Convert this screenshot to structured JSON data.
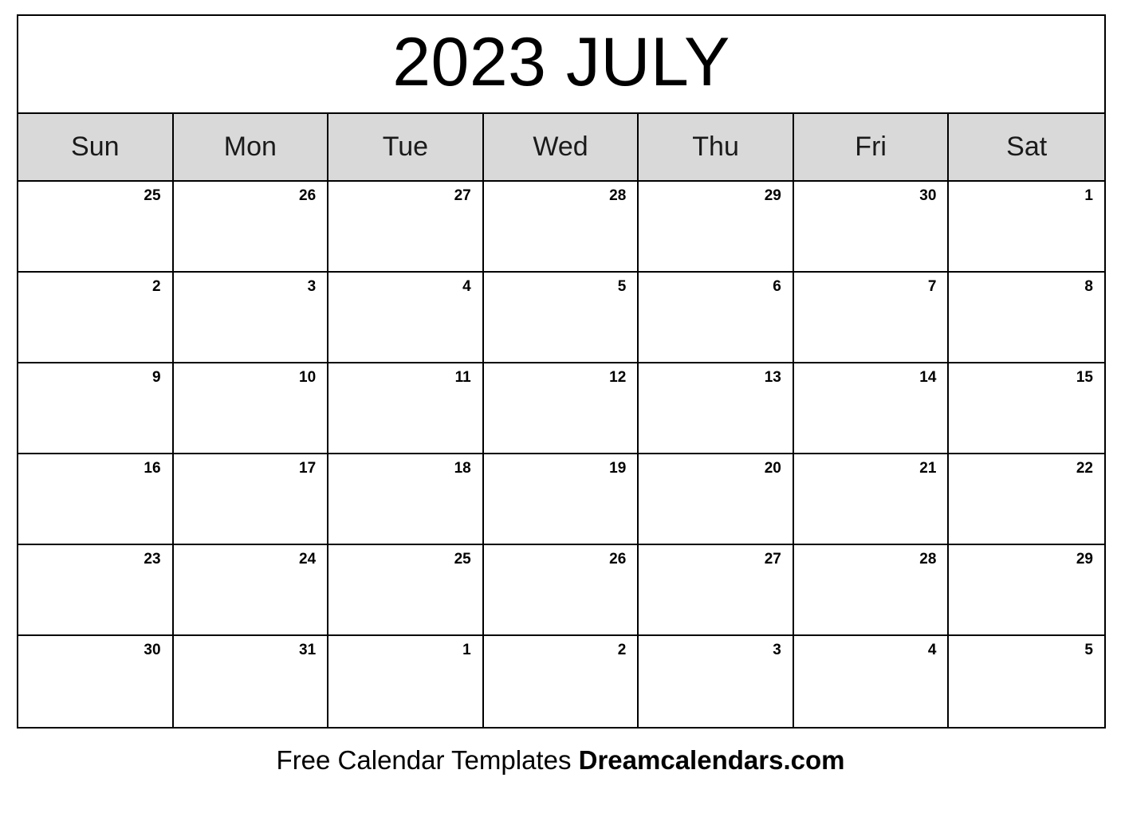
{
  "calendar": {
    "title": "2023 JULY",
    "year": "2023",
    "month": "JULY",
    "header_bg_color": "#d9d9d9",
    "border_color": "#000000",
    "text_color": "#000000",
    "weekdays": [
      {
        "label": "Sun"
      },
      {
        "label": "Mon"
      },
      {
        "label": "Tue"
      },
      {
        "label": "Wed"
      },
      {
        "label": "Thu"
      },
      {
        "label": "Fri"
      },
      {
        "label": "Sat"
      }
    ],
    "weeks": [
      {
        "days": [
          {
            "number": "25",
            "in_month": false
          },
          {
            "number": "26",
            "in_month": false
          },
          {
            "number": "27",
            "in_month": false
          },
          {
            "number": "28",
            "in_month": false
          },
          {
            "number": "29",
            "in_month": false
          },
          {
            "number": "30",
            "in_month": false
          },
          {
            "number": "1",
            "in_month": true
          }
        ]
      },
      {
        "days": [
          {
            "number": "2",
            "in_month": true
          },
          {
            "number": "3",
            "in_month": true
          },
          {
            "number": "4",
            "in_month": true
          },
          {
            "number": "5",
            "in_month": true
          },
          {
            "number": "6",
            "in_month": true
          },
          {
            "number": "7",
            "in_month": true
          },
          {
            "number": "8",
            "in_month": true
          }
        ]
      },
      {
        "days": [
          {
            "number": "9",
            "in_month": true
          },
          {
            "number": "10",
            "in_month": true
          },
          {
            "number": "11",
            "in_month": true
          },
          {
            "number": "12",
            "in_month": true
          },
          {
            "number": "13",
            "in_month": true
          },
          {
            "number": "14",
            "in_month": true
          },
          {
            "number": "15",
            "in_month": true
          }
        ]
      },
      {
        "days": [
          {
            "number": "16",
            "in_month": true
          },
          {
            "number": "17",
            "in_month": true
          },
          {
            "number": "18",
            "in_month": true
          },
          {
            "number": "19",
            "in_month": true
          },
          {
            "number": "20",
            "in_month": true
          },
          {
            "number": "21",
            "in_month": true
          },
          {
            "number": "22",
            "in_month": true
          }
        ]
      },
      {
        "days": [
          {
            "number": "23",
            "in_month": true
          },
          {
            "number": "24",
            "in_month": true
          },
          {
            "number": "25",
            "in_month": true
          },
          {
            "number": "26",
            "in_month": true
          },
          {
            "number": "27",
            "in_month": true
          },
          {
            "number": "28",
            "in_month": true
          },
          {
            "number": "29",
            "in_month": true
          }
        ]
      },
      {
        "days": [
          {
            "number": "30",
            "in_month": true
          },
          {
            "number": "31",
            "in_month": true
          },
          {
            "number": "1",
            "in_month": false
          },
          {
            "number": "2",
            "in_month": false
          },
          {
            "number": "3",
            "in_month": false
          },
          {
            "number": "4",
            "in_month": false
          },
          {
            "number": "5",
            "in_month": false
          }
        ]
      }
    ]
  },
  "footer": {
    "tagline": "Free Calendar Templates",
    "site": "Dreamcalendars.com"
  }
}
